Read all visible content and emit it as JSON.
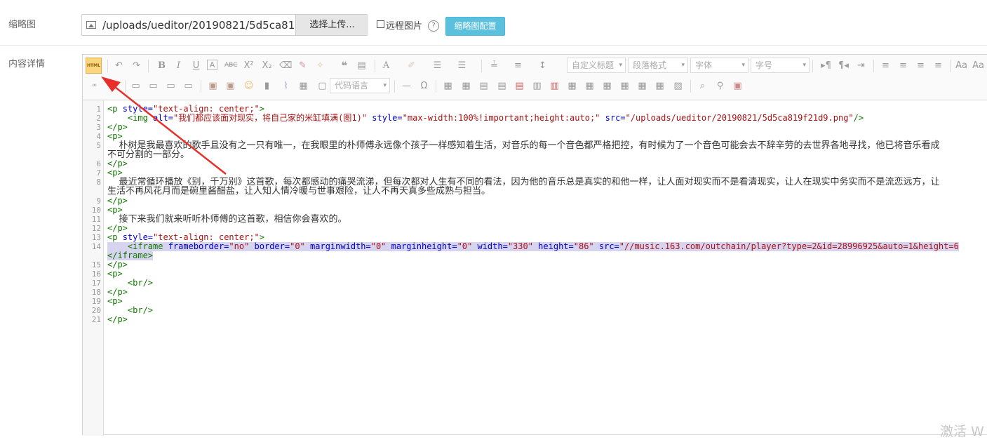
{
  "thumbnail": {
    "label": "缩略图",
    "path_value": "/uploads/ueditor/20190821/5d5ca819f21d9.png",
    "upload_label": "选择上传...",
    "remote_label": "远程图片",
    "help_glyph": "?",
    "config_label": "缩略图配置"
  },
  "content": {
    "label": "内容详情"
  },
  "toolbar": {
    "html_label": "HTML",
    "custom_title": "自定义标题",
    "paragraph": "段落格式",
    "font": "字体",
    "size": "字号",
    "code_lang": "代码语言"
  },
  "code_lines": [
    {
      "n": "1",
      "parts": [
        [
          "tag",
          "<p "
        ],
        [
          "attr",
          "style="
        ],
        [
          "str",
          "\"text-align: center;\""
        ],
        [
          "tag",
          ">"
        ]
      ]
    },
    {
      "n": "2",
      "parts": [
        [
          "tag",
          "    <img "
        ],
        [
          "attr",
          "alt="
        ],
        [
          "str",
          "\"我们都应该面对现实，将自己家的米缸填满(图1)\""
        ],
        [
          "attr",
          " style="
        ],
        [
          "str",
          "\"max-width:100%!important;height:auto;\""
        ],
        [
          "attr",
          " src="
        ],
        [
          "str",
          "\"/uploads/ueditor/20190821/5d5ca819f21d9.png\""
        ],
        [
          "tag",
          "/>"
        ]
      ]
    },
    {
      "n": "3",
      "parts": [
        [
          "tag",
          "</p>"
        ]
      ]
    },
    {
      "n": "4",
      "parts": [
        [
          "tag",
          "<p>"
        ]
      ]
    },
    {
      "n": "5",
      "parts": [
        [
          "txt",
          "    朴树是我最喜欢的歌手且没有之一只有唯一，在我眼里的朴师傅永远像个孩子一样感知着生活，对音乐的每一个音色都严格把控，有时候为了一个音色可能会去不辞辛劳的去世界各地寻找，他已将音乐看成"
        ]
      ]
    },
    {
      "n": "",
      "parts": [
        [
          "txt",
          "不可分割的一部分。"
        ]
      ]
    },
    {
      "n": "6",
      "parts": [
        [
          "tag",
          "</p>"
        ]
      ]
    },
    {
      "n": "7",
      "parts": [
        [
          "tag",
          "<p>"
        ]
      ]
    },
    {
      "n": "8",
      "parts": [
        [
          "txt",
          "    最近常循环播放《别，千万别》这首歌，每次都感动的痛哭流涕，但每次都对人生有不同的看法，因为他的音乐总是真实的和他一样，让人面对现实而不是看清现实，让人在现实中务实而不是流恋远方，让"
        ]
      ]
    },
    {
      "n": "",
      "parts": [
        [
          "txt",
          "生活不再风花月而是碗里酱醋盐，让人知人情冷暖与世事艰险，让人不再天真多些成熟与担当。"
        ]
      ]
    },
    {
      "n": "9",
      "parts": [
        [
          "tag",
          "</p>"
        ]
      ]
    },
    {
      "n": "10",
      "parts": [
        [
          "tag",
          "<p>"
        ]
      ]
    },
    {
      "n": "11",
      "parts": [
        [
          "txt",
          "    接下来我们就来听听朴师傅的这首歌，相信你会喜欢的。"
        ]
      ]
    },
    {
      "n": "12",
      "parts": [
        [
          "tag",
          "</p>"
        ]
      ]
    },
    {
      "n": "13",
      "parts": [
        [
          "tag",
          "<p "
        ],
        [
          "attr",
          "style="
        ],
        [
          "str",
          "\"text-align: center;\""
        ],
        [
          "tag",
          ">"
        ]
      ]
    },
    {
      "n": "14",
      "sel": true,
      "parts": [
        [
          "tag",
          "    <iframe "
        ],
        [
          "attr",
          "frameborder="
        ],
        [
          "str",
          "\"no\""
        ],
        [
          "attr",
          " border="
        ],
        [
          "str",
          "\"0\""
        ],
        [
          "attr",
          " marginwidth="
        ],
        [
          "str",
          "\"0\""
        ],
        [
          "attr",
          " marginheight="
        ],
        [
          "str",
          "\"0\""
        ],
        [
          "attr",
          " width="
        ],
        [
          "str",
          "\"330\""
        ],
        [
          "attr",
          " height="
        ],
        [
          "str",
          "\"86\""
        ],
        [
          "attr",
          " src="
        ],
        [
          "str",
          "\"//music.163.com/outchain/player?type=2&id=28996925&auto=1&height=6"
        ]
      ]
    },
    {
      "n": "",
      "sel": true,
      "parts": [
        [
          "tag",
          "</iframe>"
        ]
      ]
    },
    {
      "n": "15",
      "parts": [
        [
          "tag",
          "</p>"
        ]
      ]
    },
    {
      "n": "16",
      "parts": [
        [
          "tag",
          "<p>"
        ]
      ]
    },
    {
      "n": "17",
      "parts": [
        [
          "tag",
          "    <br/>"
        ]
      ]
    },
    {
      "n": "18",
      "parts": [
        [
          "tag",
          "</p>"
        ]
      ]
    },
    {
      "n": "19",
      "parts": [
        [
          "tag",
          "<p>"
        ]
      ]
    },
    {
      "n": "20",
      "parts": [
        [
          "tag",
          "    <br/>"
        ]
      ]
    },
    {
      "n": "21",
      "parts": [
        [
          "tag",
          "</p>"
        ]
      ]
    }
  ],
  "watermark": "激活 W",
  "colors": {
    "accent": "#5bc0de",
    "arrow": "#e8302a",
    "html_btn": "#fcd67f"
  }
}
